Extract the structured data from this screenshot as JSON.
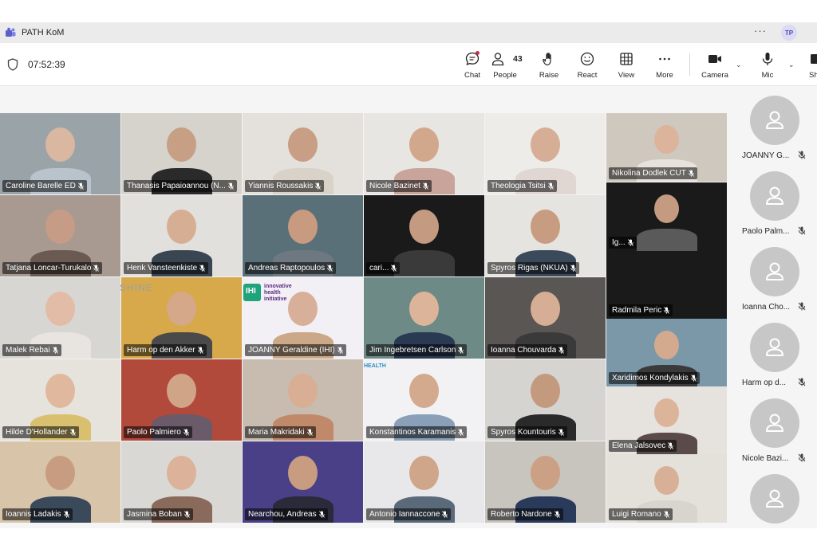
{
  "window": {
    "title": "PATH KoM",
    "more": "···",
    "user_initials": "TP"
  },
  "meeting": {
    "elapsed_time": "07:52:39"
  },
  "toolbar": {
    "chat": "Chat",
    "people": "People",
    "people_count": "43",
    "raise": "Raise",
    "react": "React",
    "view": "View",
    "more": "More",
    "camera": "Camera",
    "mic": "Mic",
    "share": "Sh"
  },
  "grid": [
    {
      "name": "Caroline Barelle ED",
      "bg": "#9aa3a8",
      "skin": "#d9b7a0",
      "shirt": "#b9c3cc"
    },
    {
      "name": "Thanasis Papaioannou (N...",
      "bg": "#d6d2cc",
      "skin": "#c79f84",
      "shirt": "#2a2a2a"
    },
    {
      "name": "Yiannis Roussakis",
      "bg": "#e4e1dc",
      "skin": "#c89e84",
      "shirt": "#d9d2c8"
    },
    {
      "name": "Nicole Bazinet",
      "bg": "#e8e6e2",
      "skin": "#d2a88c",
      "shirt": "#c9a49a"
    },
    {
      "name": "Theologia Tsitsi",
      "bg": "#eeece8",
      "skin": "#d6ae96",
      "shirt": "#e0d6d2"
    },
    {
      "name": "Nikolina Dodlek CUT",
      "bg": "#cfc8be",
      "skin": "#dcb49c",
      "shirt": "#e8e2dc"
    },
    {
      "name": "Tatjana Loncar-Turukalo",
      "bg": "#a89a90",
      "skin": "#c69c86",
      "shirt": "#6a5a52"
    },
    {
      "name": "Henk Vansteenkiste",
      "bg": "#e2e0dc",
      "skin": "#d6ae94",
      "shirt": "#3a4552"
    },
    {
      "name": "Andreas Raptopoulos",
      "bg": "#5a7078",
      "skin": "#c89a80",
      "shirt": "#6e7880"
    },
    {
      "name": "cari...",
      "bg": "#1a1a1a",
      "skin": "#c49a80",
      "shirt": "#3a3a3a"
    },
    {
      "name": "Spyros Rigas (NKUA)",
      "bg": "#e6e4e0",
      "skin": "#c89c80",
      "shirt": "#3a4a5a"
    },
    {
      "name": "Ig...",
      "bg": "#1a1a1a",
      "skin": "#c49a80",
      "shirt": "#5a5a5a"
    },
    {
      "name": "Malek Rebai",
      "bg": "#d8d6d2",
      "skin": "#e2bca6",
      "shirt": "#e8e4e0"
    },
    {
      "name": "Harm op den Akker",
      "bg": "#d8a94a",
      "skin": "#d4a888",
      "shirt": "#4a4a4a"
    },
    {
      "name": "JOANNY Geraldine (IHI)",
      "bg": "#f2f0f4",
      "skin": "#d8b09a",
      "shirt": "#caa888"
    },
    {
      "name": "Jim Ingebretsen Carlson",
      "bg": "#6e8a86",
      "skin": "#dcb49a",
      "shirt": "#2a3a52"
    },
    {
      "name": "Ioanna Chouvarda",
      "bg": "#5a5654",
      "skin": "#d6ae96",
      "shirt": "#3a3a3a"
    },
    {
      "name": "Radmila Peric",
      "bg": "#1a1a1a",
      "skin": "#1a1a1a",
      "shirt": "#1a1a1a"
    },
    {
      "name": "Hilde D'Hollander",
      "bg": "#e6e2dc",
      "skin": "#e0b89e",
      "shirt": "#d8c070"
    },
    {
      "name": "Paolo Palmiero",
      "bg": "#b24a3c",
      "skin": "#d0a486",
      "shirt": "#6a5a6a"
    },
    {
      "name": "Maria Makridaki",
      "bg": "#c8bcb0",
      "skin": "#d8ae94",
      "shirt": "#c08a6a"
    },
    {
      "name": "Konstantinos Karamanis",
      "bg": "#f2f2f4",
      "skin": "#d4aa8e",
      "shirt": "#8aa0b8"
    },
    {
      "name": "Spyros Kountouris",
      "bg": "#d6d4d0",
      "skin": "#c49a7e",
      "shirt": "#2a2a2a"
    },
    {
      "name": "Xaridimos Kondylakis",
      "bg": "#7a98a8",
      "skin": "#d4aa8e",
      "shirt": "#3a3a3a"
    },
    {
      "name": "Elena Jalsovec",
      "bg": "#e6e2de",
      "skin": "#dcb49a",
      "shirt": "#5a4a4a"
    },
    {
      "name": "Ioannis Ladakis",
      "bg": "#d8c4a8",
      "skin": "#c89c80",
      "shirt": "#3a4a5a"
    },
    {
      "name": "Jasmina Boban",
      "bg": "#dad8d4",
      "skin": "#dcb29a",
      "shirt": "#8a6a5a"
    },
    {
      "name": "Nearchou, Andreas",
      "bg": "#4a4088",
      "skin": "#c89c80",
      "shirt": "#2a2a3a"
    },
    {
      "name": "Antonio Iannaccone",
      "bg": "#e8e8ea",
      "skin": "#d0a68a",
      "shirt": "#5a6a7a"
    },
    {
      "name": "Roberto Nardone",
      "bg": "#c8c4be",
      "skin": "#cca084",
      "shirt": "#2a3a5a"
    },
    {
      "name": "Luigi Romano",
      "bg": "#e4e0da",
      "skin": "#d8b098",
      "shirt": "#d8d4ce"
    }
  ],
  "overlays": {
    "shine_logo": "SHINE",
    "ihi_logo_line1": "innovative",
    "ihi_logo_line2": "health",
    "ihi_logo_line3": "initiative",
    "ihi_mark": "IHI",
    "health_sign": "HEALTH"
  },
  "sidebar": [
    {
      "name": "JOANNY G..."
    },
    {
      "name": "Paolo Palm..."
    },
    {
      "name": "Ioanna Cho..."
    },
    {
      "name": "Harm op d..."
    },
    {
      "name": "Nicole Bazi..."
    },
    {
      "name": ""
    }
  ],
  "colors": {
    "accent": "#5b5fc7",
    "chat_badge": "#c4314b",
    "titlebar": "#ebebeb",
    "stage": "#f5f5f5"
  }
}
